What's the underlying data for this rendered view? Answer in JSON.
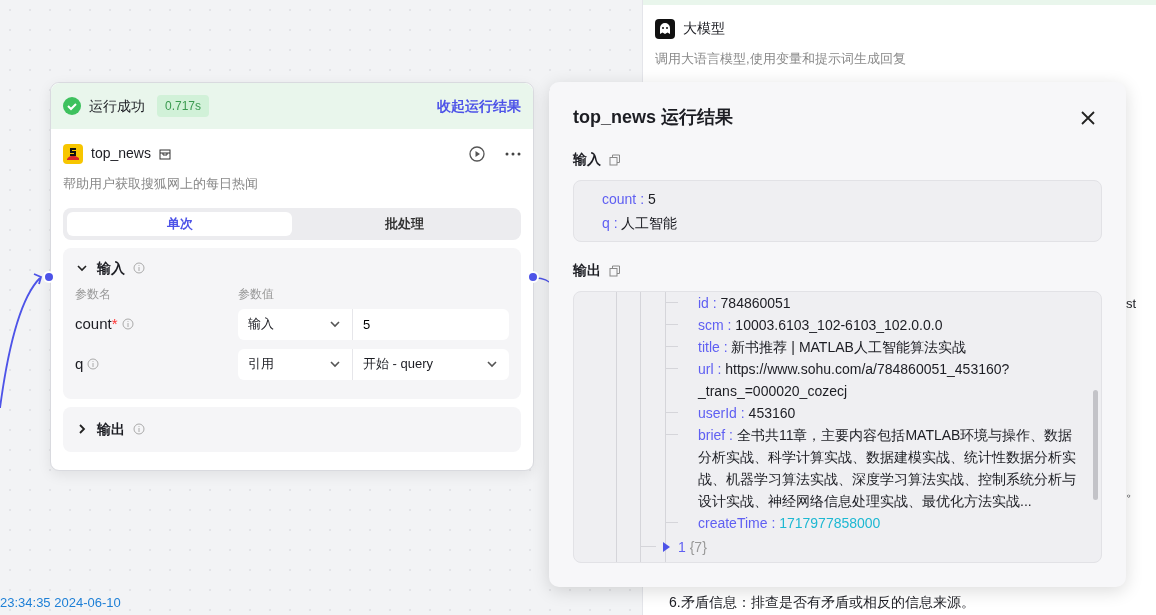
{
  "canvas": {
    "timestamp": "23:34:35 2024-06-10"
  },
  "node": {
    "status": "运行成功",
    "duration": "0.717s",
    "collapse_link": "收起运行结果",
    "name": "top_news",
    "description": "帮助用户获取搜狐网上的每日热闻",
    "tabs": [
      {
        "label": "单次",
        "selected": true
      },
      {
        "label": "批处理",
        "selected": false
      }
    ],
    "input_section": {
      "title": "输入",
      "expanded": true,
      "required_mark": "*",
      "headers": [
        "参数名",
        "参数值"
      ],
      "params": [
        {
          "name": "count",
          "required": true,
          "mode": "输入",
          "kind": "text",
          "value": "5"
        },
        {
          "name": "q",
          "required": false,
          "mode": "引用",
          "kind": "select",
          "value": "开始 - query"
        }
      ]
    },
    "output_section": {
      "title": "输出",
      "expanded": false
    }
  },
  "background_node": {
    "name": "大模型",
    "description": "调用大语言模型,使用变量和提示词生成回复",
    "fragments": [
      "st",
      "。"
    ],
    "text": "6.矛盾信息：排查是否有矛盾或相反的信息来源。"
  },
  "result_panel": {
    "title": "top_news 运行结果",
    "separator": ":",
    "input_label": "输入",
    "inputs": [
      {
        "key": "count",
        "value": "5"
      },
      {
        "key": "q",
        "value": "人工智能"
      }
    ],
    "output_label": "输出",
    "output_fields": [
      {
        "key": "id",
        "value": "784860051",
        "kind": "string"
      },
      {
        "key": "scm",
        "value": "10003.6103_102-6103_102.0.0.0",
        "kind": "string"
      },
      {
        "key": "title",
        "value": "新书推荐 | MATLAB人工智能算法实战",
        "kind": "string"
      },
      {
        "key": "url",
        "value": "https://www.sohu.com/a/784860051_453160?_trans_=000020_cozecj",
        "kind": "string"
      },
      {
        "key": "userId",
        "value": "453160",
        "kind": "string"
      },
      {
        "key": "brief",
        "value": "全书共11章，主要内容包括MATLAB环境与操作、数据分析实战、科学计算实战、数据建模实战、统计性数据分析实战、机器学习算法实战、深度学习算法实战、控制系统分析与设计实战、神经网络信息处理实战、最优化方法实战...",
        "kind": "string"
      },
      {
        "key": "createTime",
        "value": "1717977858000",
        "kind": "number"
      }
    ],
    "collapsed_items": [
      {
        "index": "1",
        "count": "{7}",
        "expanded": false
      }
    ]
  }
}
